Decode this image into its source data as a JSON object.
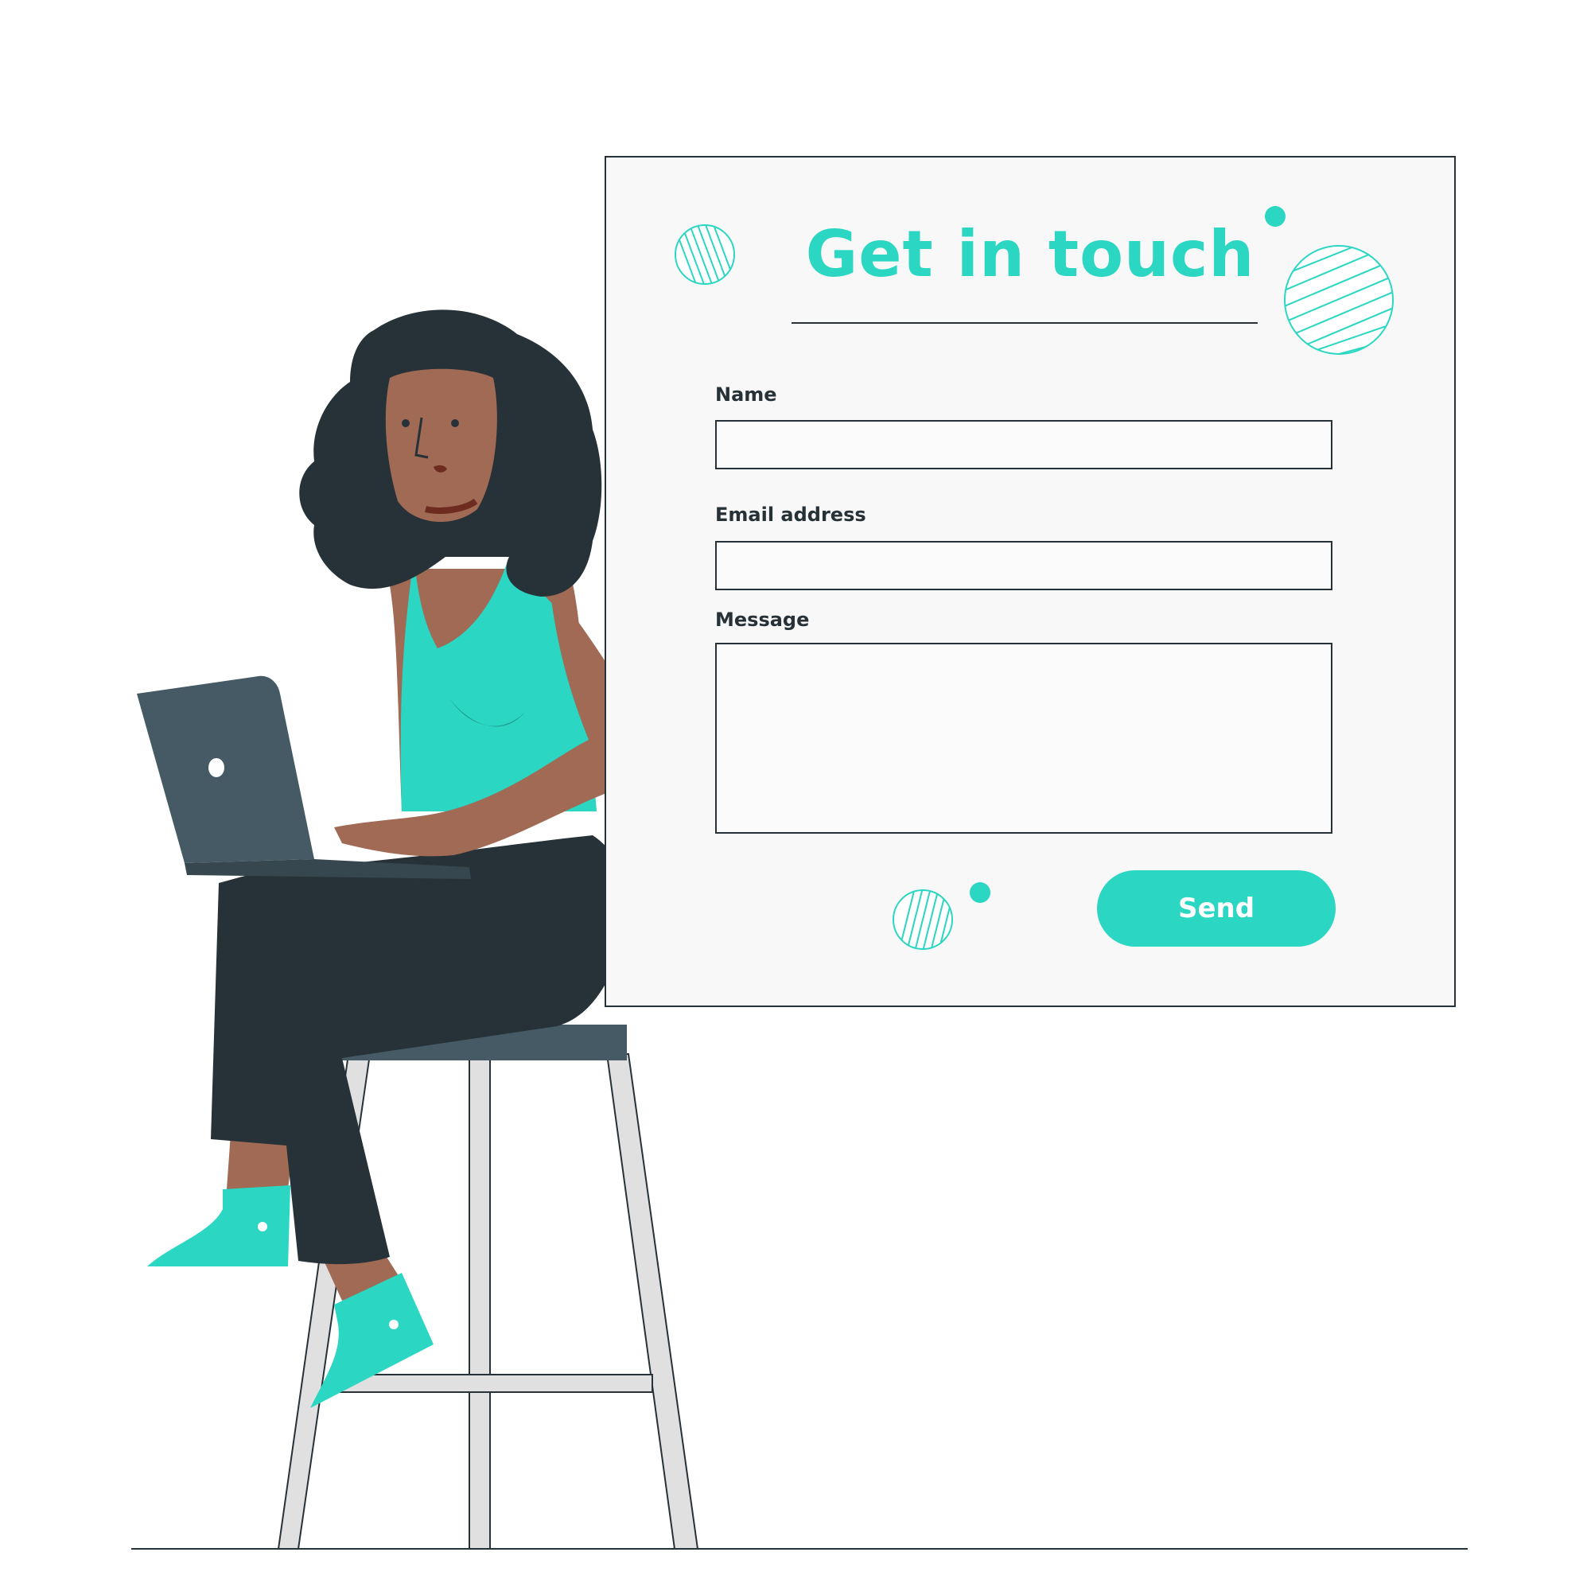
{
  "form": {
    "title": "Get in touch",
    "name_label": "Name",
    "name_value": "",
    "email_label": "Email address",
    "email_value": "",
    "message_label": "Message",
    "message_value": "",
    "send_label": "Send"
  },
  "colors": {
    "accent": "#2bd6c3",
    "dark": "#263238",
    "panel": "#f8f8f8",
    "skin": "#a06a55",
    "laptop": "#455a64"
  },
  "icons": [
    "hatched-circle-icon",
    "teal-dot-icon",
    "laptop-logo-icon"
  ]
}
